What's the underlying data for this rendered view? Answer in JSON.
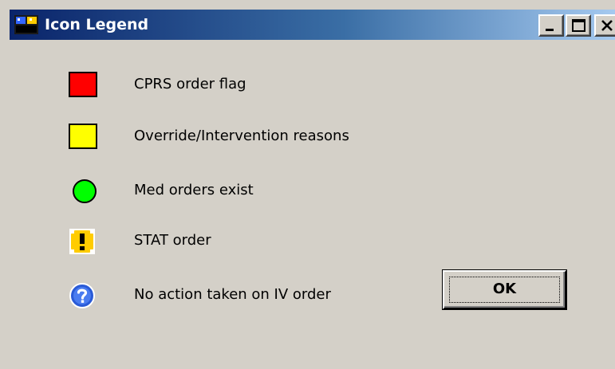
{
  "window": {
    "title": "Icon Legend",
    "background": "#d4d0c8"
  },
  "title_buttons": {
    "minimize_icon": "minimize-icon",
    "maximize_icon": "maximize-icon",
    "close_icon": "close-icon"
  },
  "legend": {
    "items": [
      {
        "icon": "red-square-icon",
        "color": "#ff0000",
        "label": "CPRS order flag"
      },
      {
        "icon": "yellow-square-icon",
        "color": "#ffff00",
        "label": "Override/Intervention reasons"
      },
      {
        "icon": "green-circle-icon",
        "color": "#00ff00",
        "label": "Med orders exist"
      },
      {
        "icon": "stat-exclamation-icon",
        "color": "#ffcc00",
        "label": "STAT order"
      },
      {
        "icon": "question-mark-icon",
        "color": "#2a5bd7",
        "label": "No action taken on IV order"
      }
    ]
  },
  "ok_button": {
    "label": "OK"
  }
}
